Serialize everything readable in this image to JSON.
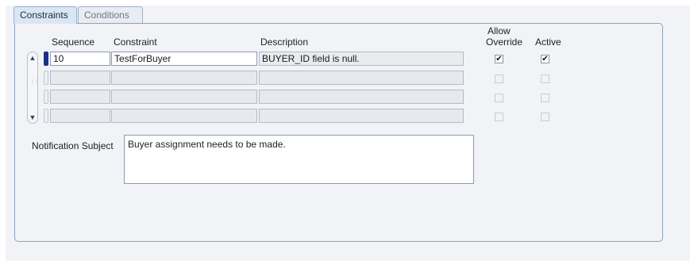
{
  "tabs": [
    {
      "label": "Constraints",
      "active": true
    },
    {
      "label": "Conditions",
      "active": false
    }
  ],
  "columns": {
    "sequence": "Sequence",
    "constraint": "Constraint",
    "description": "Description",
    "allow_override_line1": "Allow",
    "allow_override_line2": "Override",
    "active": "Active"
  },
  "rows": [
    {
      "sequence": "10",
      "constraint": "TestForBuyer",
      "description": "BUYER_ID field is null.",
      "allow_override": true,
      "active": true
    },
    {
      "sequence": "",
      "constraint": "",
      "description": "",
      "allow_override": false,
      "active": false
    },
    {
      "sequence": "",
      "constraint": "",
      "description": "",
      "allow_override": false,
      "active": false
    },
    {
      "sequence": "",
      "constraint": "",
      "description": "",
      "allow_override": false,
      "active": false
    }
  ],
  "notification": {
    "label": "Notification Subject",
    "value": "Buyer assignment needs to be made."
  },
  "icons": {
    "scroll_up": "▲",
    "scroll_down": "▼",
    "check": "✔"
  },
  "colors": {
    "current_row_marker": "#1b2f8a",
    "tab_active": "#dbe6f4",
    "frame_border": "#8ea2bf"
  }
}
